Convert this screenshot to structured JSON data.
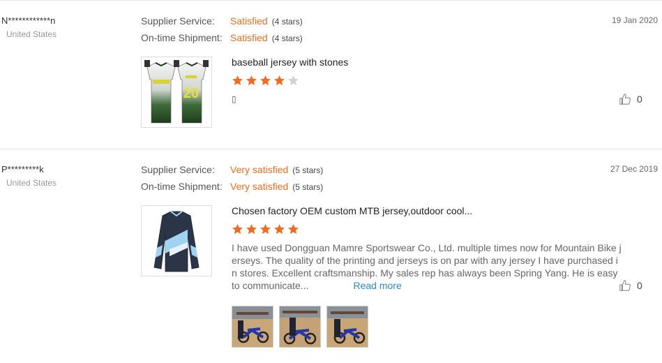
{
  "reviews": [
    {
      "user": "N************n",
      "country": "United States",
      "date": "19 Jan 2020",
      "supplier_label": "Supplier Service:",
      "supplier_value": "Satisfied",
      "supplier_stars": "(4 stars)",
      "shipment_label": "On-time Shipment:",
      "shipment_value": "Satisfied",
      "shipment_stars": "(4 stars)",
      "product_title": "baseball jersey with stones",
      "rating": 4,
      "comment_glyph": "▯",
      "likes": "0"
    },
    {
      "user": "P*********k",
      "country": "United States",
      "date": "27 Dec 2019",
      "supplier_label": "Supplier Service:",
      "supplier_value": "Very satisfied",
      "supplier_stars": "(5 stars)",
      "shipment_label": "On-time Shipment:",
      "shipment_value": "Very satisfied",
      "shipment_stars": "(5 stars)",
      "product_title": "Chosen factory OEM custom MTB jersey,outdoor cool...",
      "rating": 5,
      "comment": "I have used Dongguan Mamre Sportswear Co., Ltd. multiple times now for Mountain Bike jerseys. The quality of the printing and jerseys is on par with any jersey I have purchased in stores. Excellent craftsmanship. My sales rep has always been Spring Yang. He is easy to communicate...",
      "read_more": "Read more",
      "likes": "0"
    }
  ],
  "colors": {
    "accent": "#f06b1e",
    "link": "#2a8ad4",
    "star_off": "#d2d2d2"
  }
}
